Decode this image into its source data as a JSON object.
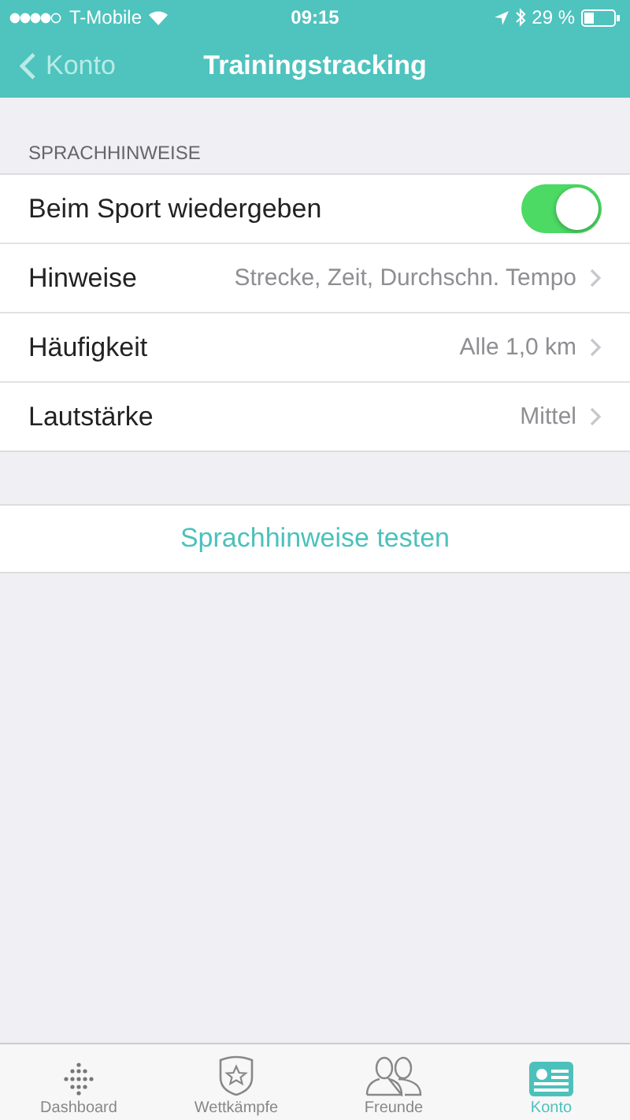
{
  "status_bar": {
    "carrier": "T-Mobile",
    "time": "09:15",
    "battery": "29 %"
  },
  "nav": {
    "back": "Konto",
    "title": "Trainingstracking"
  },
  "section": {
    "header": "SPRACHHINWEISE",
    "rows": [
      {
        "kind": "toggle",
        "label": "Beim Sport wiedergeben",
        "on": true
      },
      {
        "kind": "value",
        "label": "Hinweise",
        "value": "Strecke, Zeit, Durchschn. Tempo"
      },
      {
        "kind": "value",
        "label": "Häufigkeit",
        "value": "Alle 1,0 km"
      },
      {
        "kind": "value",
        "label": "Lautstärke",
        "value": "Mittel"
      }
    ]
  },
  "test_button": "Sprachhinweise testen",
  "tabs": [
    {
      "kind": "dashboard",
      "label": "Dashboard",
      "selected": false
    },
    {
      "kind": "challenges",
      "label": "Wettkämpfe",
      "selected": false
    },
    {
      "kind": "friends",
      "label": "Freunde",
      "selected": false
    },
    {
      "kind": "account",
      "label": "Konto",
      "selected": true
    }
  ]
}
